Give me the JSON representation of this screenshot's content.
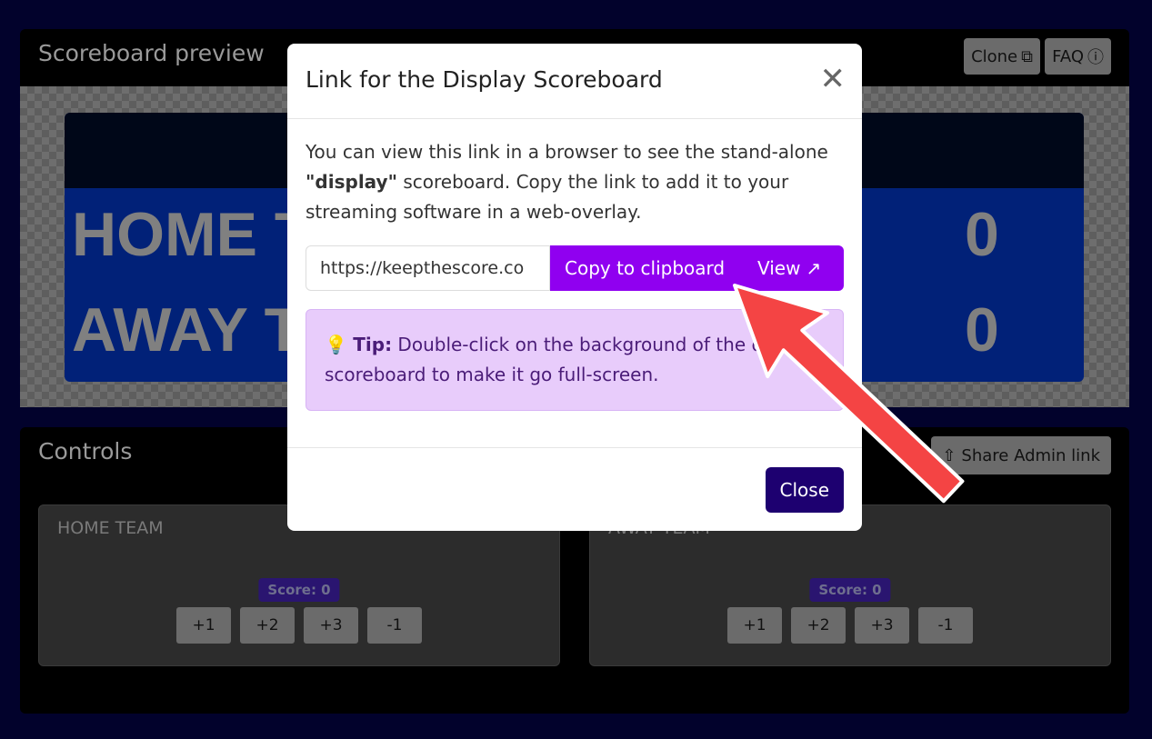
{
  "preview": {
    "title": "Scoreboard preview",
    "clone_label": "Clone",
    "faq_label": "FAQ",
    "teams": [
      {
        "name": "HOME TEAM",
        "score": "0"
      },
      {
        "name": "AWAY TEAM",
        "score": "0"
      }
    ]
  },
  "controls": {
    "title": "Controls",
    "share_label": "Share Admin link",
    "teams": [
      {
        "name": "HOME TEAM",
        "score_badge": "Score: 0",
        "buttons": [
          "+1",
          "+2",
          "+3",
          "-1"
        ]
      },
      {
        "name": "AWAY TEAM",
        "score_badge": "Score: 0",
        "buttons": [
          "+1",
          "+2",
          "+3",
          "-1"
        ]
      }
    ]
  },
  "modal": {
    "title": "Link for the Display Scoreboard",
    "body_pre": "You can view this link in a browser to see the stand-alone ",
    "body_bold": "\"display\"",
    "body_post": " scoreboard. Copy the link to add it to your streaming software in a web-overlay.",
    "link_value": "https://keepthescore.co",
    "copy_label": "Copy to clipboard",
    "view_label": "View",
    "tip_label": "Tip:",
    "tip_text": " Double-click on the background of the display scoreboard to make it go full-screen.",
    "close_label": "Close"
  },
  "colors": {
    "accent": "#9000f0",
    "close_button": "#1d0070",
    "tip_bg": "#e8ccfb",
    "arrow": "#f44444",
    "page_bg": "#02022c"
  }
}
